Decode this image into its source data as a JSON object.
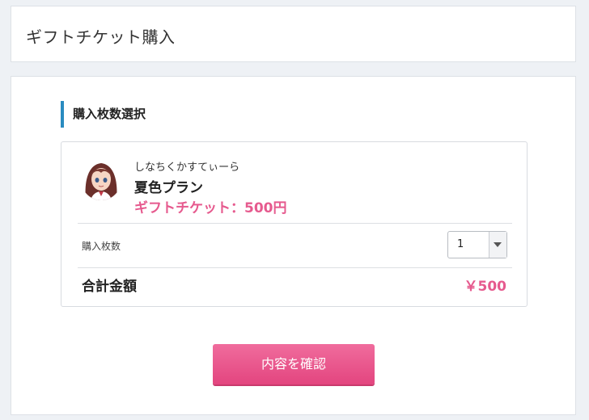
{
  "header": {
    "title": "ギフトチケット購入"
  },
  "section": {
    "heading": "購入枚数選択",
    "accent_color": "#2a8bc0"
  },
  "item": {
    "creator_name": "しなちくかすてぃーら",
    "plan_name": "夏色プラン",
    "ticket_label": "ギフトチケット：500円",
    "avatar_icon": "anime-girl-avatar"
  },
  "quantity": {
    "label": "購入枚数",
    "selected": "1",
    "icon": "dropdown-arrow-icon"
  },
  "total": {
    "label": "合計金額",
    "amount": "￥500"
  },
  "actions": {
    "confirm_label": "内容を確認"
  },
  "colors": {
    "accent_pink": "#e65a8e",
    "button_pink": "#ea5a8e"
  }
}
